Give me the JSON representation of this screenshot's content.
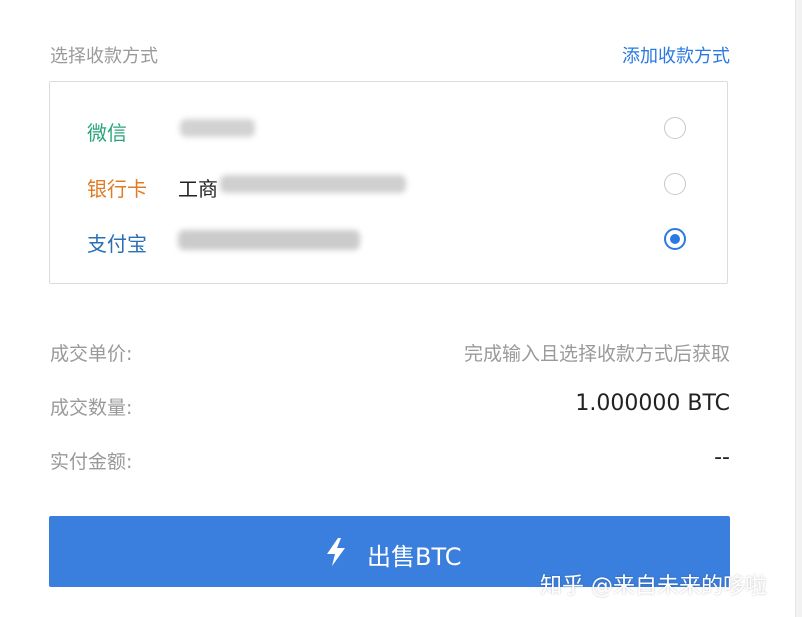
{
  "header": {
    "section_label": "选择收款方式",
    "add_link": "添加收款方式"
  },
  "payment_methods": [
    {
      "name": "微信",
      "name_color": "#2aa47a",
      "account": "",
      "selected": false
    },
    {
      "name": "银行卡",
      "name_color": "#e07b24",
      "account": "工商",
      "selected": false
    },
    {
      "name": "支付宝",
      "name_color": "#2a6fb8",
      "account": "",
      "selected": true
    }
  ],
  "summary": {
    "price_label": "成交单价:",
    "price_value": "完成输入且选择收款方式后获取",
    "quantity_label": "成交数量:",
    "quantity_value": "1.000000 BTC",
    "amount_label": "实付金额:",
    "amount_value": "--"
  },
  "sell_button": {
    "label": "出售BTC",
    "icon": "lightning-icon",
    "color": "#3b7fde"
  },
  "watermark": "知乎 @来自未来的哆啦"
}
